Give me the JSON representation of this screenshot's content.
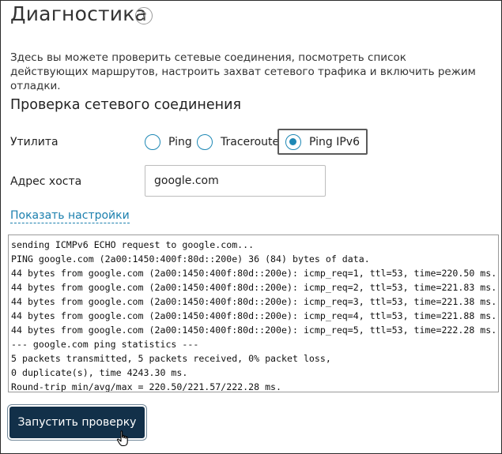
{
  "page": {
    "title": "Диагностика",
    "help_symbol": "?",
    "description": "Здесь вы можете проверить сетевые соединения, посмотреть список действующих маршрутов, настроить захват сетевого трафика и включить режим отладки."
  },
  "connection_check": {
    "section_title": "Проверка сетевого соединения",
    "utility_label": "Утилита",
    "utilities": [
      {
        "label": "Ping",
        "selected": false
      },
      {
        "label": "Traceroute",
        "selected": false
      },
      {
        "label": "Ping IPv6",
        "selected": true
      }
    ],
    "host_label": "Адрес хоста",
    "host_value": "google.com",
    "settings_link": "Показать настройки"
  },
  "output": {
    "lines": [
      "sending ICMPv6 ECHO request to google.com...",
      "PING google.com (2a00:1450:400f:80d::200e) 36 (84) bytes of data.",
      "44 bytes from google.com (2a00:1450:400f:80d::200e): icmp_req=1, ttl=53, time=220.50 ms.",
      "44 bytes from google.com (2a00:1450:400f:80d::200e): icmp_req=2, ttl=53, time=221.83 ms.",
      "44 bytes from google.com (2a00:1450:400f:80d::200e): icmp_req=3, ttl=53, time=221.38 ms.",
      "44 bytes from google.com (2a00:1450:400f:80d::200e): icmp_req=4, ttl=53, time=221.88 ms.",
      "44 bytes from google.com (2a00:1450:400f:80d::200e): icmp_req=5, ttl=53, time=222.28 ms.",
      "--- google.com ping statistics ---",
      "5 packets transmitted, 5 packets received, 0% packet loss,",
      "0 duplicate(s), time 4243.30 ms.",
      "Round-trip min/avg/max = 220.50/221.57/222.28 ms."
    ]
  },
  "actions": {
    "run_label": "Запустить проверку"
  },
  "icons": {
    "help": "help-icon",
    "cursor": "hand-pointer-icon"
  },
  "colors": {
    "accent": "#1e88b5",
    "link": "#1a7fae",
    "button_bg": "#123049"
  }
}
